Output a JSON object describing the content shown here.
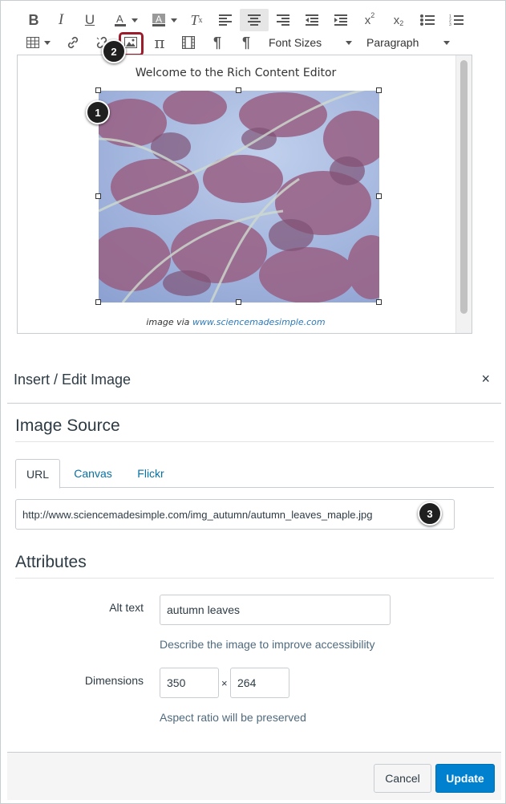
{
  "toolbar": {
    "font_sizes_label": "Font Sizes",
    "paragraph_label": "Paragraph"
  },
  "editor": {
    "heading": "Welcome to the Rich Content Editor",
    "caption_prefix": "image via",
    "caption_link": "www.sciencemadesimple.com"
  },
  "callouts": [
    "1",
    "2",
    "3"
  ],
  "dialog": {
    "title": "Insert / Edit Image",
    "close_symbol": "×",
    "image_source_heading": "Image Source",
    "tabs": [
      {
        "label": "URL"
      },
      {
        "label": "Canvas"
      },
      {
        "label": "Flickr"
      }
    ],
    "url_value": "http://www.sciencemadesimple.com/img_autumn/autumn_leaves_maple.jpg",
    "attributes_heading": "Attributes",
    "alt_text_label": "Alt text",
    "alt_text_value": "autumn leaves",
    "alt_text_hint": "Describe the image to improve accessibility",
    "dimensions_label": "Dimensions",
    "width_value": "350",
    "dimension_separator": "×",
    "height_value": "264",
    "dimensions_hint": "Aspect ratio will be preserved",
    "cancel_label": "Cancel",
    "update_label": "Update"
  },
  "colors": {
    "accent": "#0081cf",
    "link": "#0770a3",
    "callout_highlight": "#9b1c2b"
  }
}
